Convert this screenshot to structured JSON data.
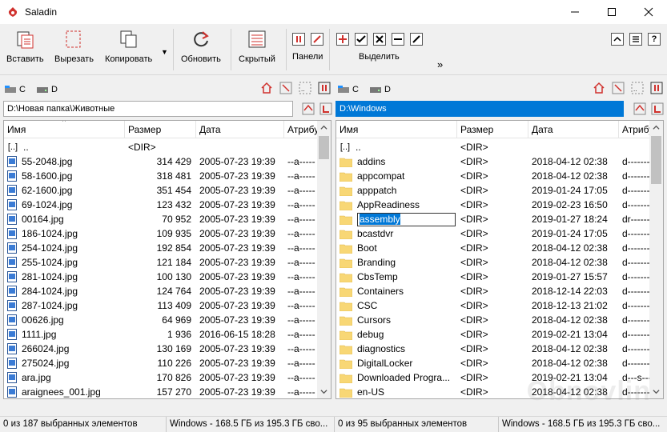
{
  "window": {
    "title": "Saladin",
    "accent": "#0078d7",
    "brand": "#d0312d"
  },
  "toolbar": {
    "paste": "Вставить",
    "cut": "Вырезать",
    "copy": "Копировать",
    "refresh": "Обновить",
    "hidden": "Скрытый",
    "panels": "Панели",
    "select": "Выделить",
    "more": "»"
  },
  "left": {
    "drives": [
      "C",
      "D"
    ],
    "path": "D:\\Новая папка\\Животные",
    "headers": [
      "Имя",
      "Размер",
      "Дата",
      "Атрибуты"
    ],
    "rows": [
      {
        "name": "..",
        "size": "<DIR>",
        "date": "",
        "attr": "",
        "type": "up"
      },
      {
        "name": "55-2048.jpg",
        "size": "314 429",
        "date": "2005-07-23 19:39",
        "attr": "--a-----",
        "type": "file"
      },
      {
        "name": "58-1600.jpg",
        "size": "318 481",
        "date": "2005-07-23 19:39",
        "attr": "--a-----",
        "type": "file"
      },
      {
        "name": "62-1600.jpg",
        "size": "351 454",
        "date": "2005-07-23 19:39",
        "attr": "--a-----",
        "type": "file"
      },
      {
        "name": "69-1024.jpg",
        "size": "123 432",
        "date": "2005-07-23 19:39",
        "attr": "--a-----",
        "type": "file"
      },
      {
        "name": "00164.jpg",
        "size": "70 952",
        "date": "2005-07-23 19:39",
        "attr": "--a-----",
        "type": "file"
      },
      {
        "name": "186-1024.jpg",
        "size": "109 935",
        "date": "2005-07-23 19:39",
        "attr": "--a-----",
        "type": "file"
      },
      {
        "name": "254-1024.jpg",
        "size": "192 854",
        "date": "2005-07-23 19:39",
        "attr": "--a-----",
        "type": "file"
      },
      {
        "name": "255-1024.jpg",
        "size": "121 184",
        "date": "2005-07-23 19:39",
        "attr": "--a-----",
        "type": "file"
      },
      {
        "name": "281-1024.jpg",
        "size": "100 130",
        "date": "2005-07-23 19:39",
        "attr": "--a-----",
        "type": "file"
      },
      {
        "name": "284-1024.jpg",
        "size": "124 764",
        "date": "2005-07-23 19:39",
        "attr": "--a-----",
        "type": "file"
      },
      {
        "name": "287-1024.jpg",
        "size": "113 409",
        "date": "2005-07-23 19:39",
        "attr": "--a-----",
        "type": "file"
      },
      {
        "name": "00626.jpg",
        "size": "64 969",
        "date": "2005-07-23 19:39",
        "attr": "--a-----",
        "type": "file"
      },
      {
        "name": "1111.jpg",
        "size": "1 936",
        "date": "2016-06-15 18:28",
        "attr": "--a-----",
        "type": "file"
      },
      {
        "name": "266024.jpg",
        "size": "130 169",
        "date": "2005-07-23 19:39",
        "attr": "--a-----",
        "type": "file"
      },
      {
        "name": "275024.jpg",
        "size": "110 226",
        "date": "2005-07-23 19:39",
        "attr": "--a-----",
        "type": "file"
      },
      {
        "name": "ara.jpg",
        "size": "170 826",
        "date": "2005-07-23 19:39",
        "attr": "--a-----",
        "type": "file"
      },
      {
        "name": "araignees_001.jpg",
        "size": "157 270",
        "date": "2005-07-23 19:39",
        "attr": "--a-----",
        "type": "file"
      }
    ],
    "status_left": "0 из 187 выбранных элементов",
    "status_right": "Windows - 168.5 ГБ из 195.3 ГБ сво..."
  },
  "right": {
    "drives": [
      "C",
      "D"
    ],
    "path": "D:\\Windows",
    "headers": [
      "Имя",
      "Размер",
      "Дата",
      "Атрибуты"
    ],
    "rename_value": "assembly",
    "rows": [
      {
        "name": "..",
        "size": "<DIR>",
        "date": "",
        "attr": "",
        "type": "up"
      },
      {
        "name": "addins",
        "size": "<DIR>",
        "date": "2018-04-12 02:38",
        "attr": "d-------",
        "type": "folder"
      },
      {
        "name": "appcompat",
        "size": "<DIR>",
        "date": "2018-04-12 02:38",
        "attr": "d-------",
        "type": "folder"
      },
      {
        "name": "apppatch",
        "size": "<DIR>",
        "date": "2019-01-24 17:05",
        "attr": "d-------",
        "type": "folder"
      },
      {
        "name": "AppReadiness",
        "size": "<DIR>",
        "date": "2019-02-23 16:50",
        "attr": "d-------",
        "type": "folder"
      },
      {
        "name": "assembly",
        "size": "<DIR>",
        "date": "2019-01-27 18:24",
        "attr": "dr------",
        "type": "rename"
      },
      {
        "name": "bcastdvr",
        "size": "<DIR>",
        "date": "2019-01-24 17:05",
        "attr": "d-------",
        "type": "folder"
      },
      {
        "name": "Boot",
        "size": "<DIR>",
        "date": "2018-04-12 02:38",
        "attr": "d-------",
        "type": "folder"
      },
      {
        "name": "Branding",
        "size": "<DIR>",
        "date": "2018-04-12 02:38",
        "attr": "d-------",
        "type": "folder"
      },
      {
        "name": "CbsTemp",
        "size": "<DIR>",
        "date": "2019-01-27 15:57",
        "attr": "d-------",
        "type": "folder"
      },
      {
        "name": "Containers",
        "size": "<DIR>",
        "date": "2018-12-14 22:03",
        "attr": "d-------",
        "type": "folder"
      },
      {
        "name": "CSC",
        "size": "<DIR>",
        "date": "2018-12-13 21:02",
        "attr": "d-------",
        "type": "folder"
      },
      {
        "name": "Cursors",
        "size": "<DIR>",
        "date": "2018-04-12 02:38",
        "attr": "d-------",
        "type": "folder"
      },
      {
        "name": "debug",
        "size": "<DIR>",
        "date": "2019-02-21 13:04",
        "attr": "d-------",
        "type": "folder"
      },
      {
        "name": "diagnostics",
        "size": "<DIR>",
        "date": "2018-04-12 02:38",
        "attr": "d-------",
        "type": "folder"
      },
      {
        "name": "DigitalLocker",
        "size": "<DIR>",
        "date": "2018-04-12 02:38",
        "attr": "d-------",
        "type": "folder"
      },
      {
        "name": "Downloaded Progra...",
        "size": "<DIR>",
        "date": "2019-02-21 13:04",
        "attr": "d---s---",
        "type": "folder"
      },
      {
        "name": "en-US",
        "size": "<DIR>",
        "date": "2018-04-12 02:38",
        "attr": "d-------",
        "type": "folder"
      }
    ],
    "status_left": "0 из 95 выбранных элементов",
    "status_right": "Windows - 168.5 ГБ из 195.3 ГБ сво..."
  },
  "watermark": "Obnovlin"
}
